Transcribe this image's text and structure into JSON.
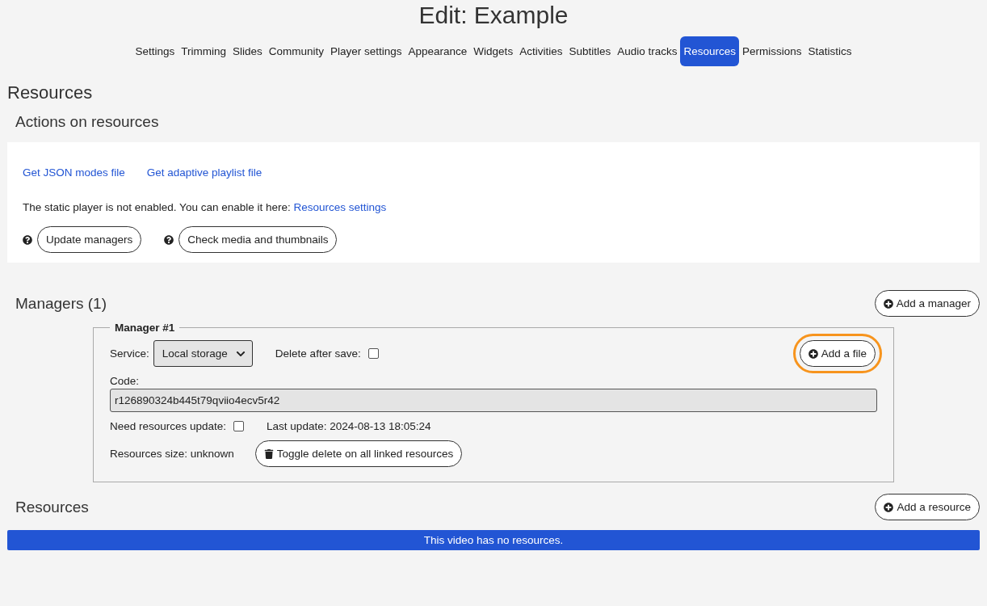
{
  "title": "Edit: Example",
  "tabs": [
    {
      "label": "Settings",
      "selected": false
    },
    {
      "label": "Trimming",
      "selected": false
    },
    {
      "label": "Slides",
      "selected": false
    },
    {
      "label": "Community",
      "selected": false
    },
    {
      "label": "Player settings",
      "selected": false
    },
    {
      "label": "Appearance",
      "selected": false
    },
    {
      "label": "Widgets",
      "selected": false
    },
    {
      "label": "Activities",
      "selected": false
    },
    {
      "label": "Subtitles",
      "selected": false
    },
    {
      "label": "Audio tracks",
      "selected": false
    },
    {
      "label": "Resources",
      "selected": true
    },
    {
      "label": "Permissions",
      "selected": false
    },
    {
      "label": "Statistics",
      "selected": false
    }
  ],
  "page_heading": "Resources",
  "actions": {
    "heading": "Actions on resources",
    "links": [
      "Get JSON modes file",
      "Get adaptive playlist file"
    ],
    "notice": "The static player is not enabled. You can enable it here:",
    "notice_link": "Resources settings",
    "buttons": [
      "Update managers",
      "Check media and thumbnails"
    ]
  },
  "managers": {
    "heading": "Managers (1)",
    "add_button": "Add a manager",
    "items": [
      {
        "legend": "Manager #1",
        "service_label": "Service:",
        "service_value": "Local storage",
        "delete_label": "Delete after save:",
        "delete_checked": false,
        "add_file_button": "Add a file",
        "add_file_highlighted": true,
        "code_label": "Code:",
        "code_value": "r126890324b445t79qviio4ecv5r42",
        "update_label": "Need resources update:",
        "update_checked": false,
        "last_update": "Last update: 2024-08-13 18:05:24",
        "size": "Resources size: unknown",
        "toggle_button": "Toggle delete on all linked resources"
      }
    ]
  },
  "resources": {
    "heading": "Resources",
    "add_button": "Add a resource",
    "empty_message": "This video has no resources."
  }
}
